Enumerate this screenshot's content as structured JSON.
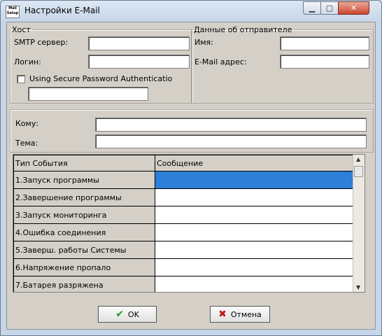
{
  "window": {
    "title": "Настройки E-Mail",
    "icon_text": "Mail Setup"
  },
  "host": {
    "legend": "Хост",
    "smtp_label": "SMTP сервер:",
    "login_label": "Логин:",
    "spa_label": "Using Secure Password Authenticatio",
    "smtp_value": "",
    "login_value": "",
    "spa_value": ""
  },
  "sender": {
    "legend": "Данные об отправителе",
    "name_label": "Имя:",
    "email_label": "E-Mail адрес:",
    "name_value": "",
    "email_value": ""
  },
  "recipient": {
    "to_label": "Кому:",
    "subject_label": "Тема:",
    "to_value": "",
    "subject_value": ""
  },
  "grid": {
    "headers": [
      "Тип События",
      "Сообщение"
    ],
    "rows": [
      "1.Запуск программы",
      "2.Завершение программы",
      "3.Запуск мониторинга",
      "4.Ошибка соединения",
      "5.Заверш. работы Системы",
      "6.Напряжение пропало",
      "7.Батарея разряжена"
    ]
  },
  "buttons": {
    "ok": "OK",
    "cancel": "Отмена"
  },
  "colors": {
    "selection": "#2e7fd8"
  }
}
